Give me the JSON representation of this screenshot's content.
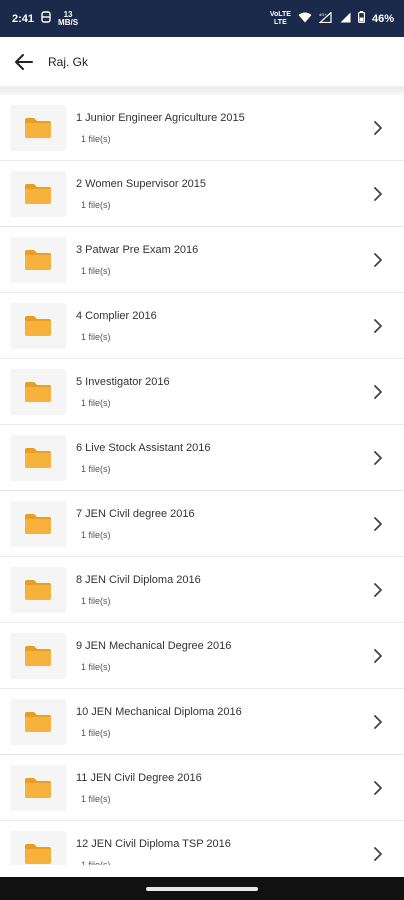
{
  "status_bar": {
    "time": "2:41",
    "left_small": "13\nMB/S",
    "net_label": "VoLTE\nLTE",
    "battery": "46%"
  },
  "app_bar": {
    "title": "Raj. Gk"
  },
  "items": [
    {
      "title": "1 Junior Engineer Agriculture 2015",
      "sub": "1 file(s)"
    },
    {
      "title": "2 Women Supervisor 2015",
      "sub": "1 file(s)"
    },
    {
      "title": "3 Patwar Pre Exam 2016",
      "sub": "1 file(s)"
    },
    {
      "title": "4 Complier 2016",
      "sub": "1 file(s)"
    },
    {
      "title": "5 Investigator 2016",
      "sub": "1 file(s)"
    },
    {
      "title": "6 Live Stock Assistant 2016",
      "sub": "1 file(s)"
    },
    {
      "title": "7 JEN Civil degree 2016",
      "sub": "1 file(s)"
    },
    {
      "title": "8 JEN Civil Diploma 2016",
      "sub": "1 file(s)"
    },
    {
      "title": "9 JEN Mechanical Degree 2016",
      "sub": "1 file(s)"
    },
    {
      "title": "10 JEN Mechanical Diploma 2016",
      "sub": "1 file(s)"
    },
    {
      "title": "11 JEN Civil Degree 2016",
      "sub": "1 file(s)"
    },
    {
      "title": "12 JEN Civil Diploma TSP 2016",
      "sub": "1 file(s)"
    }
  ],
  "colors": {
    "status_bg": "#1b2a4a",
    "folder": "#f6b23c",
    "folder_dark": "#e89e23"
  }
}
